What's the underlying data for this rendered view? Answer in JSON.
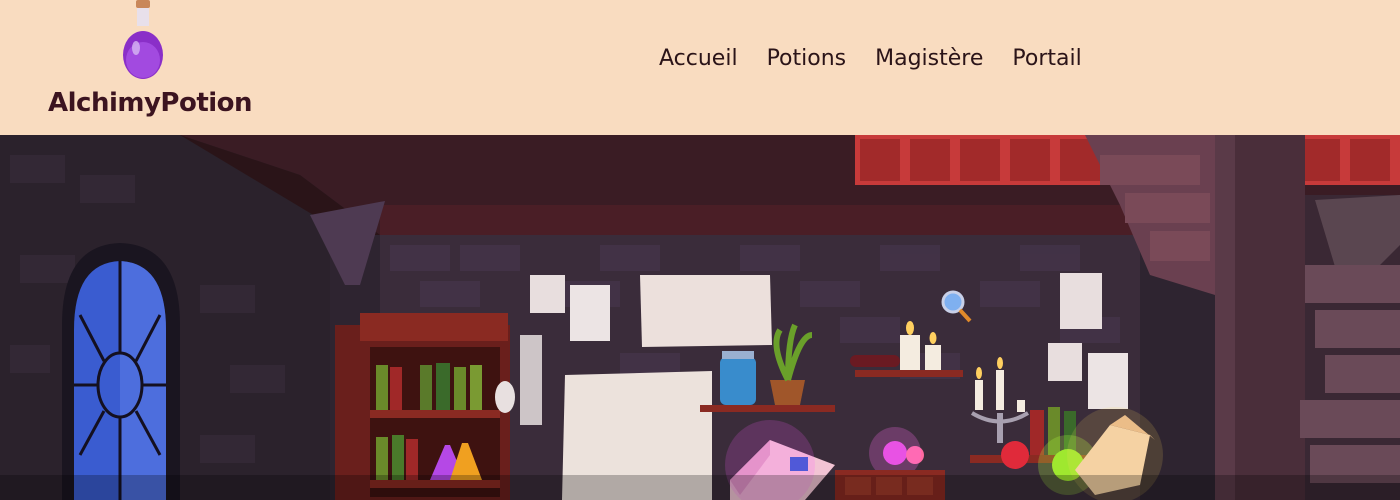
{
  "brand": {
    "name": "AlchimyPotion",
    "logo_icon": "potion-bottle-icon"
  },
  "nav": {
    "items": [
      {
        "label": "Accueil"
      },
      {
        "label": "Potions"
      },
      {
        "label": "Magistère"
      },
      {
        "label": "Portail"
      }
    ]
  },
  "hero": {
    "illustration": "alchemy-lab-illustration"
  },
  "colors": {
    "header_bg": "#f9dcc0",
    "text_dark": "#3c1420",
    "potion_purple": "#9b3fd6",
    "wall_dark": "#2e2430",
    "window_blue": "#3a5cd0"
  }
}
